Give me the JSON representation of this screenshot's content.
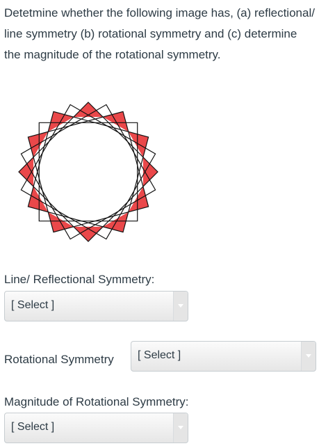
{
  "question": {
    "text": "Detetmine whether the following image has, (a) reflectional/ line symmetry (b) rotational symmetry and (c) determine the magnitude of the rotational symmetry."
  },
  "figure": {
    "square_count": 6,
    "fill_color": "#e8383b",
    "stroke_color": "#111111"
  },
  "fields": [
    {
      "label": "Line/ Reflectional Symmetry:",
      "value": "[ Select ]"
    },
    {
      "label": "Rotational Symmetry",
      "value": "[ Select ]"
    },
    {
      "label": "Magnitude of Rotational Symmetry:",
      "value": "[ Select ]"
    }
  ]
}
